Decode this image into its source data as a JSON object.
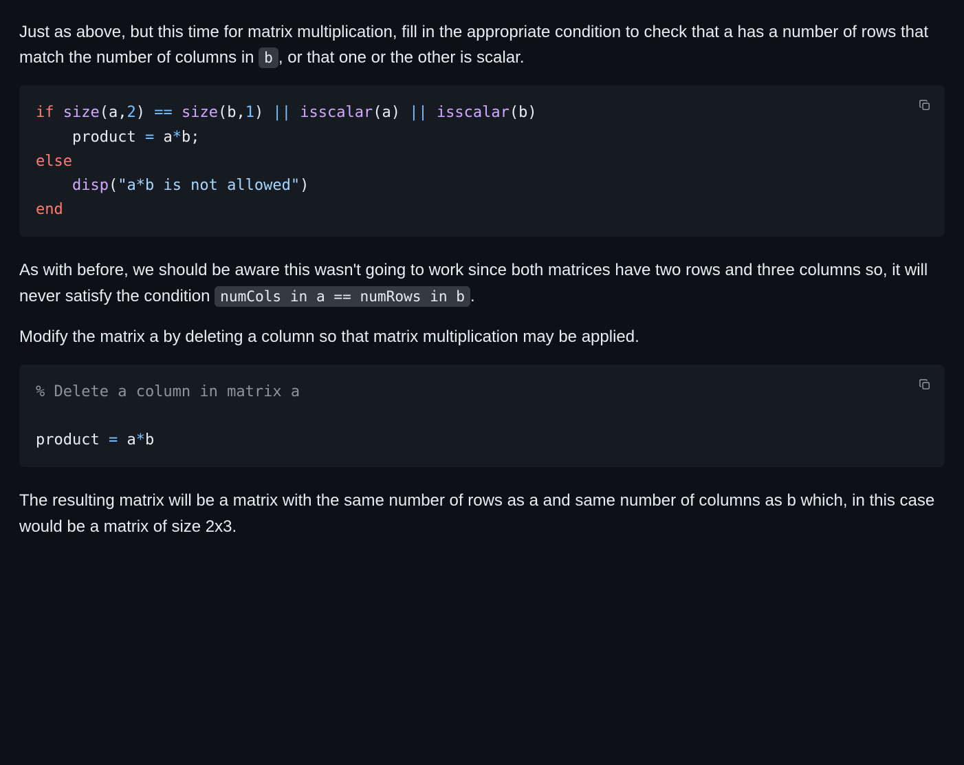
{
  "para1": {
    "pre": "Just as above, but this time for matrix multiplication, fill in the appropriate condition to check that a has a number of rows that match the number of columns in ",
    "code": "b",
    "post": ", or that one or the other is scalar."
  },
  "code1": {
    "l1": {
      "kw": "if",
      "fn1": "size",
      "p1": "(",
      "v1": "a",
      "c1": ",",
      "n1": "2",
      "p2": ")",
      "sp1": " ",
      "op1": "==",
      "sp2": " ",
      "fn2": "size",
      "p3": "(",
      "v2": "b",
      "c2": ",",
      "n2": "1",
      "p4": ")",
      "sp3": " ",
      "op2": "||",
      "sp4": " ",
      "fn3": "isscalar",
      "p5": "(",
      "v3": "a",
      "p6": ")",
      "sp5": " ",
      "op3": "||",
      "sp6": " ",
      "fn4": "isscalar",
      "p7": "(",
      "v4": "b",
      "p8": ")"
    },
    "l2": {
      "indent": "    ",
      "v1": "product",
      "sp1": " ",
      "op": "=",
      "sp2": " ",
      "v2": "a",
      "star": "*",
      "v3": "b",
      "semi": ";"
    },
    "l3": {
      "kw": "else"
    },
    "l4": {
      "indent": "    ",
      "fn": "disp",
      "p1": "(",
      "str": "\"a*b is not allowed\"",
      "p2": ")"
    },
    "l5": {
      "kw": "end"
    }
  },
  "para2": {
    "pre": "As with before, we should be aware this wasn't going to work since both matrices have two rows and three columns so, it will never satisfy the condition ",
    "code": "numCols in a == numRows in b",
    "post": "."
  },
  "para3": "Modify the matrix a by deleting a column so that matrix multiplication may be applied.",
  "code2": {
    "l1": {
      "cmt": "% Delete a column in matrix a"
    },
    "blank": "",
    "l2": {
      "v1": "product",
      "sp1": " ",
      "op": "=",
      "sp2": " ",
      "v2": "a",
      "star": "*",
      "v3": "b"
    }
  },
  "para4": "The resulting matrix will be a matrix with the same number of rows as a and same number of columns as b which, in this case would be a matrix of size 2x3.",
  "icons": {
    "copy": "copy-icon"
  }
}
